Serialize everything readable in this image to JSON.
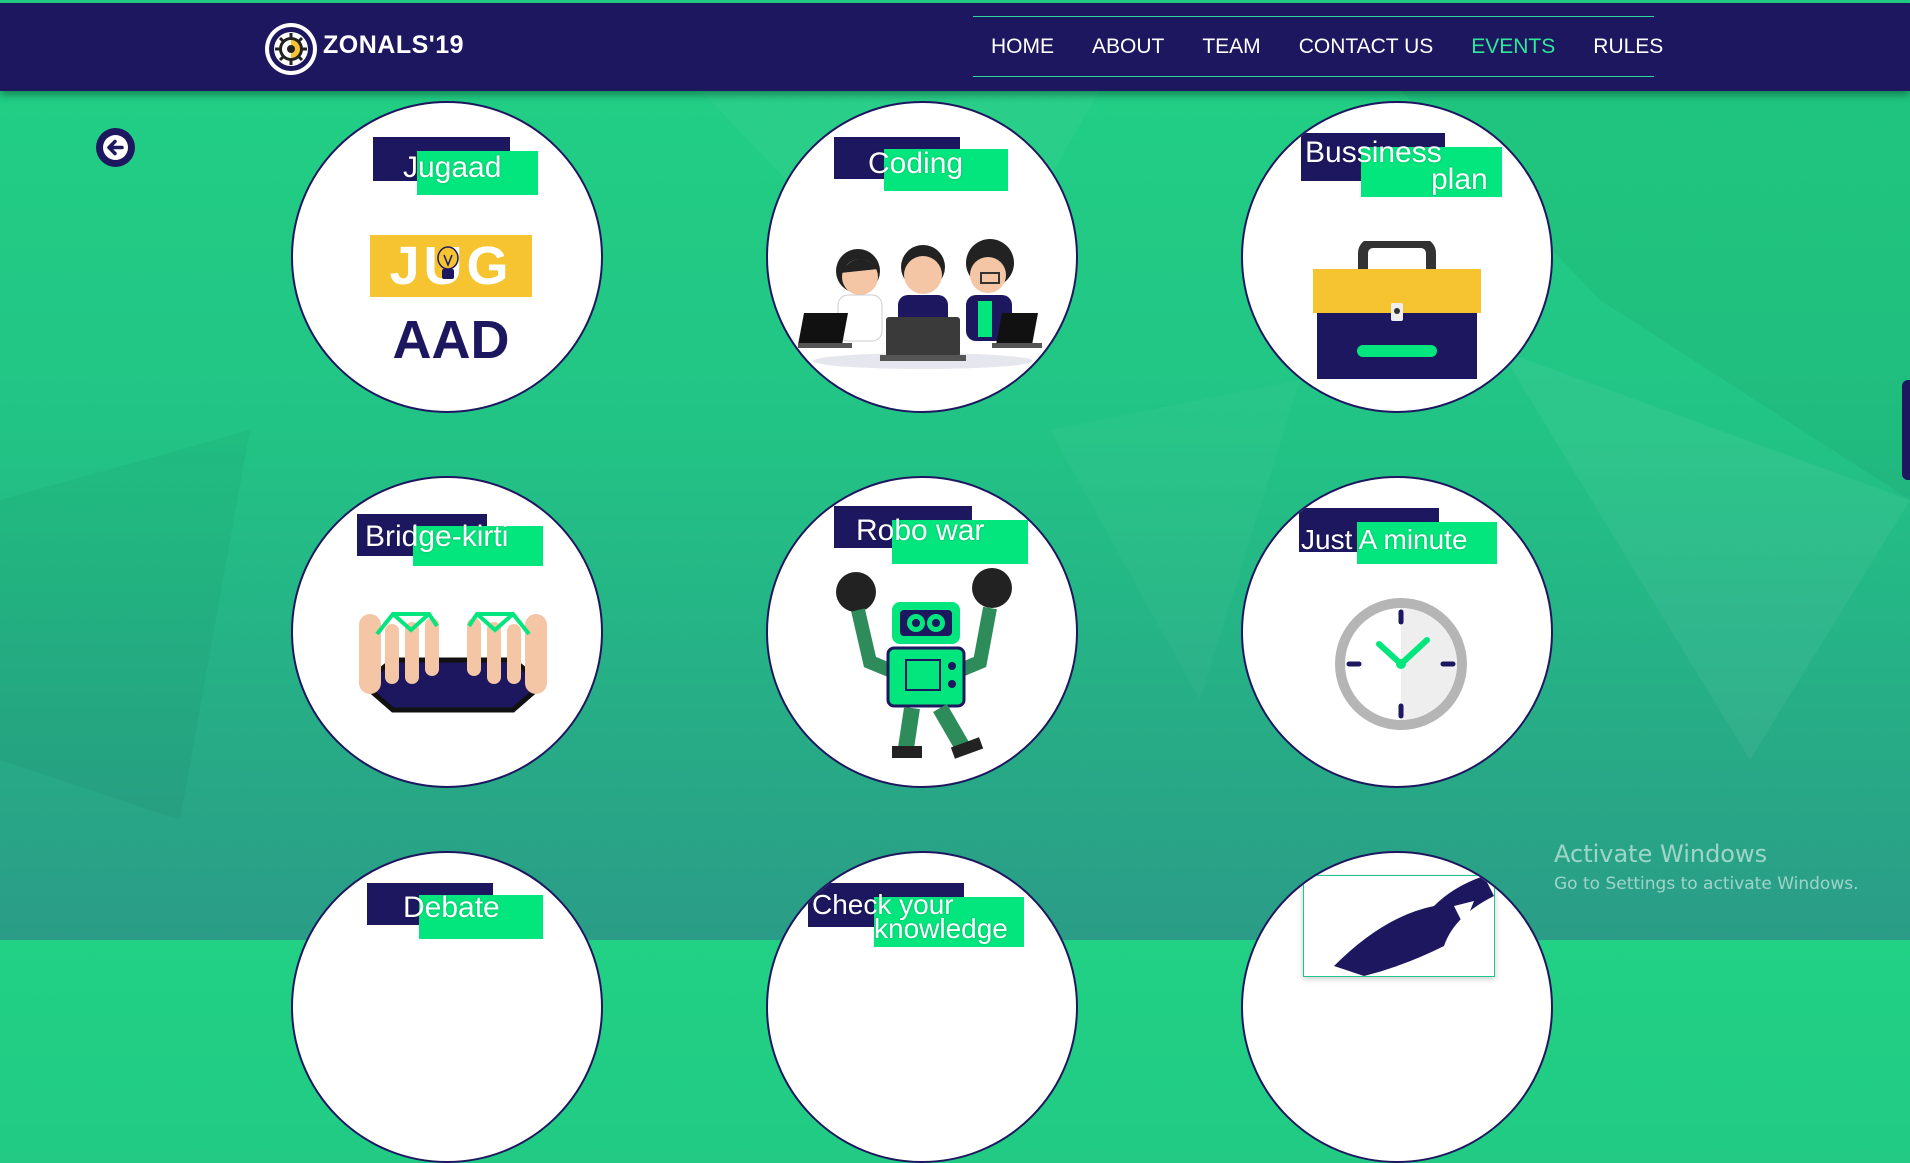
{
  "brand": {
    "name": "ZONALS'19"
  },
  "nav": {
    "items": [
      {
        "label": "HOME",
        "active": false
      },
      {
        "label": "ABOUT",
        "active": false
      },
      {
        "label": "TEAM",
        "active": false
      },
      {
        "label": "CONTACT US",
        "active": false
      },
      {
        "label": "EVENTS",
        "active": true
      },
      {
        "label": "RULES",
        "active": false
      }
    ]
  },
  "events": {
    "jugaad": {
      "title": "Jugaad",
      "logo_top": "JUG",
      "logo_bottom": "AAD"
    },
    "coding": {
      "title": "Coding"
    },
    "business": {
      "title_line1": "Bussiness",
      "title_line2": "plan"
    },
    "bridge": {
      "title": "Bridge-kirti"
    },
    "robo": {
      "title": "Robo war"
    },
    "minute": {
      "title": "Just A minute"
    },
    "debate": {
      "title": "Debate"
    },
    "knowledge": {
      "title_line1": "Check your",
      "title_line2": "knowledge"
    }
  },
  "watermark": {
    "title": "Activate Windows",
    "subtitle": "Go to Settings to activate Windows."
  },
  "colors": {
    "navy": "#1d1760",
    "accent_green": "#03e67d",
    "active_nav": "#2ee89a",
    "yellow": "#f6c431"
  }
}
